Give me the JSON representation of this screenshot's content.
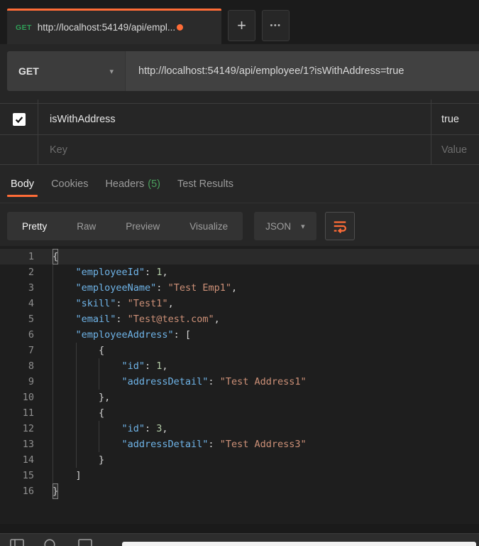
{
  "colors": {
    "accent_orange": "#ff6c37",
    "method_green": "#2f9e57",
    "headers_count_green": "#4a9e5c",
    "json_key_blue": "#6fb4e8",
    "json_string_orange": "#ce9178",
    "json_number_green": "#b5cea8",
    "code_background": "#1e1e1e"
  },
  "window": {
    "tab": {
      "method": "GET",
      "title": "http://localhost:54149/api/empl...",
      "unsaved": true
    },
    "new_tab_label": "+",
    "more_tabs_label": "•••"
  },
  "request": {
    "method": "GET",
    "url": "http://localhost:54149/api/employee/1?isWithAddress=true",
    "method_chevron": "▾"
  },
  "params": {
    "row": {
      "checked": true,
      "key": "isWithAddress",
      "value": "true"
    },
    "key_placeholder": "Key",
    "value_placeholder": "Value"
  },
  "response_tabs": {
    "body": "Body",
    "cookies": "Cookies",
    "headers": "Headers",
    "headers_count": "(5)",
    "test_results": "Test Results"
  },
  "view_bar": {
    "modes": [
      "Pretty",
      "Raw",
      "Preview",
      "Visualize"
    ],
    "active_mode": "Pretty",
    "language": "JSON",
    "language_chevron": "▾"
  },
  "code": {
    "active_line": 1,
    "lines": [
      {
        "n": 1,
        "indent": 0,
        "tokens": [
          [
            "hl",
            "{"
          ]
        ]
      },
      {
        "n": 2,
        "indent": 1,
        "tokens": [
          [
            "k",
            "\"employeeId\""
          ],
          [
            "p",
            ": "
          ],
          [
            "n",
            "1"
          ],
          [
            "p",
            ","
          ]
        ]
      },
      {
        "n": 3,
        "indent": 1,
        "tokens": [
          [
            "k",
            "\"employeeName\""
          ],
          [
            "p",
            ": "
          ],
          [
            "s",
            "\"Test Emp1\""
          ],
          [
            "p",
            ","
          ]
        ]
      },
      {
        "n": 4,
        "indent": 1,
        "tokens": [
          [
            "k",
            "\"skill\""
          ],
          [
            "p",
            ": "
          ],
          [
            "s",
            "\"Test1\""
          ],
          [
            "p",
            ","
          ]
        ]
      },
      {
        "n": 5,
        "indent": 1,
        "tokens": [
          [
            "k",
            "\"email\""
          ],
          [
            "p",
            ": "
          ],
          [
            "s",
            "\"Test@test.com\""
          ],
          [
            "p",
            ","
          ]
        ]
      },
      {
        "n": 6,
        "indent": 1,
        "tokens": [
          [
            "k",
            "\"employeeAddress\""
          ],
          [
            "p",
            ": ["
          ]
        ]
      },
      {
        "n": 7,
        "indent": 2,
        "tokens": [
          [
            "p",
            "{"
          ]
        ]
      },
      {
        "n": 8,
        "indent": 3,
        "tokens": [
          [
            "k",
            "\"id\""
          ],
          [
            "p",
            ": "
          ],
          [
            "n",
            "1"
          ],
          [
            "p",
            ","
          ]
        ]
      },
      {
        "n": 9,
        "indent": 3,
        "tokens": [
          [
            "k",
            "\"addressDetail\""
          ],
          [
            "p",
            ": "
          ],
          [
            "s",
            "\"Test Address1\""
          ]
        ]
      },
      {
        "n": 10,
        "indent": 2,
        "tokens": [
          [
            "p",
            "},"
          ]
        ]
      },
      {
        "n": 11,
        "indent": 2,
        "tokens": [
          [
            "p",
            "{"
          ]
        ]
      },
      {
        "n": 12,
        "indent": 3,
        "tokens": [
          [
            "k",
            "\"id\""
          ],
          [
            "p",
            ": "
          ],
          [
            "n",
            "3"
          ],
          [
            "p",
            ","
          ]
        ]
      },
      {
        "n": 13,
        "indent": 3,
        "tokens": [
          [
            "k",
            "\"addressDetail\""
          ],
          [
            "p",
            ": "
          ],
          [
            "s",
            "\"Test Address3\""
          ]
        ]
      },
      {
        "n": 14,
        "indent": 2,
        "tokens": [
          [
            "p",
            "}"
          ]
        ]
      },
      {
        "n": 15,
        "indent": 1,
        "tokens": [
          [
            "p",
            "]"
          ]
        ]
      },
      {
        "n": 16,
        "indent": 0,
        "tokens": [
          [
            "hl",
            "}"
          ]
        ]
      }
    ]
  }
}
